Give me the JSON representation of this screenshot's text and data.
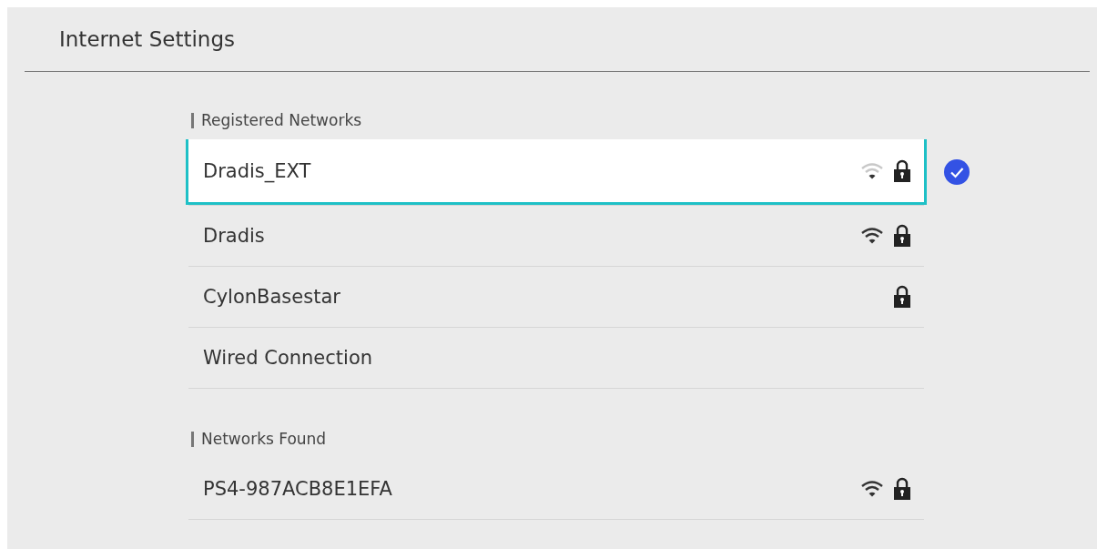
{
  "window": {
    "title": "Internet Settings"
  },
  "sections": [
    {
      "heading": "Registered Networks",
      "networks": [
        {
          "name": "Dradis_EXT",
          "selected": true,
          "connected": true,
          "wifi": true,
          "weak_signal": true,
          "secured": true
        },
        {
          "name": "Dradis",
          "selected": false,
          "connected": false,
          "wifi": true,
          "weak_signal": false,
          "secured": true
        },
        {
          "name": "CylonBasestar",
          "selected": false,
          "connected": false,
          "wifi": false,
          "secured": true
        },
        {
          "name": "Wired Connection",
          "selected": false,
          "connected": false,
          "wifi": false,
          "secured": false
        }
      ]
    },
    {
      "heading": "Networks Found",
      "networks": [
        {
          "name": "PS4-987ACB8E1EFA",
          "selected": false,
          "connected": false,
          "wifi": true,
          "weak_signal": false,
          "secured": true
        }
      ]
    }
  ]
}
